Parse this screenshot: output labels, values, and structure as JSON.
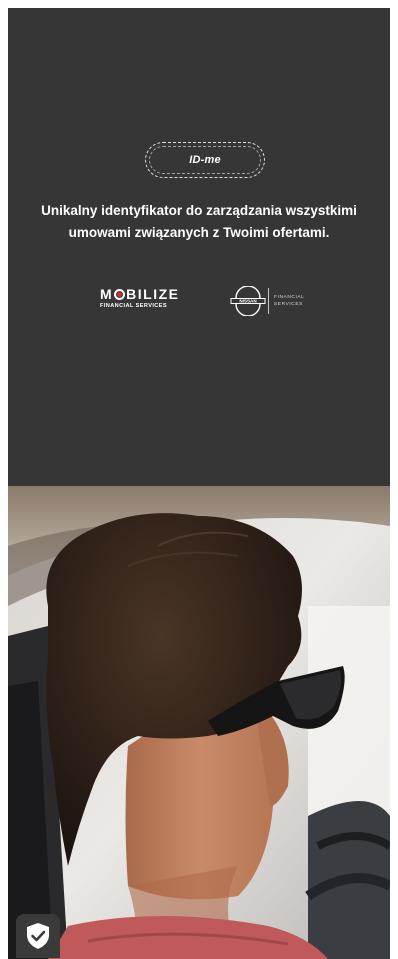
{
  "hero": {
    "idme_label": "ID-me",
    "tagline_line1": "Unikalny identyfikator do zarządzania wszystkimi",
    "tagline_line2": "umowami związanych z Twoimi ofertami."
  },
  "logos": {
    "mobilize_name": "MOBILIZE",
    "mobilize_sub": "FINANCIAL SERVICES",
    "nissan_name": "NISSAN",
    "nissan_fs_line1": "FINANCIAL",
    "nissan_fs_line2": "SERVICES"
  },
  "colors": {
    "hero_bg": "#363636",
    "text": "#ffffff",
    "mobilize_accent": "#d82a2a"
  },
  "icons": {
    "badge": "shield-check-icon"
  }
}
